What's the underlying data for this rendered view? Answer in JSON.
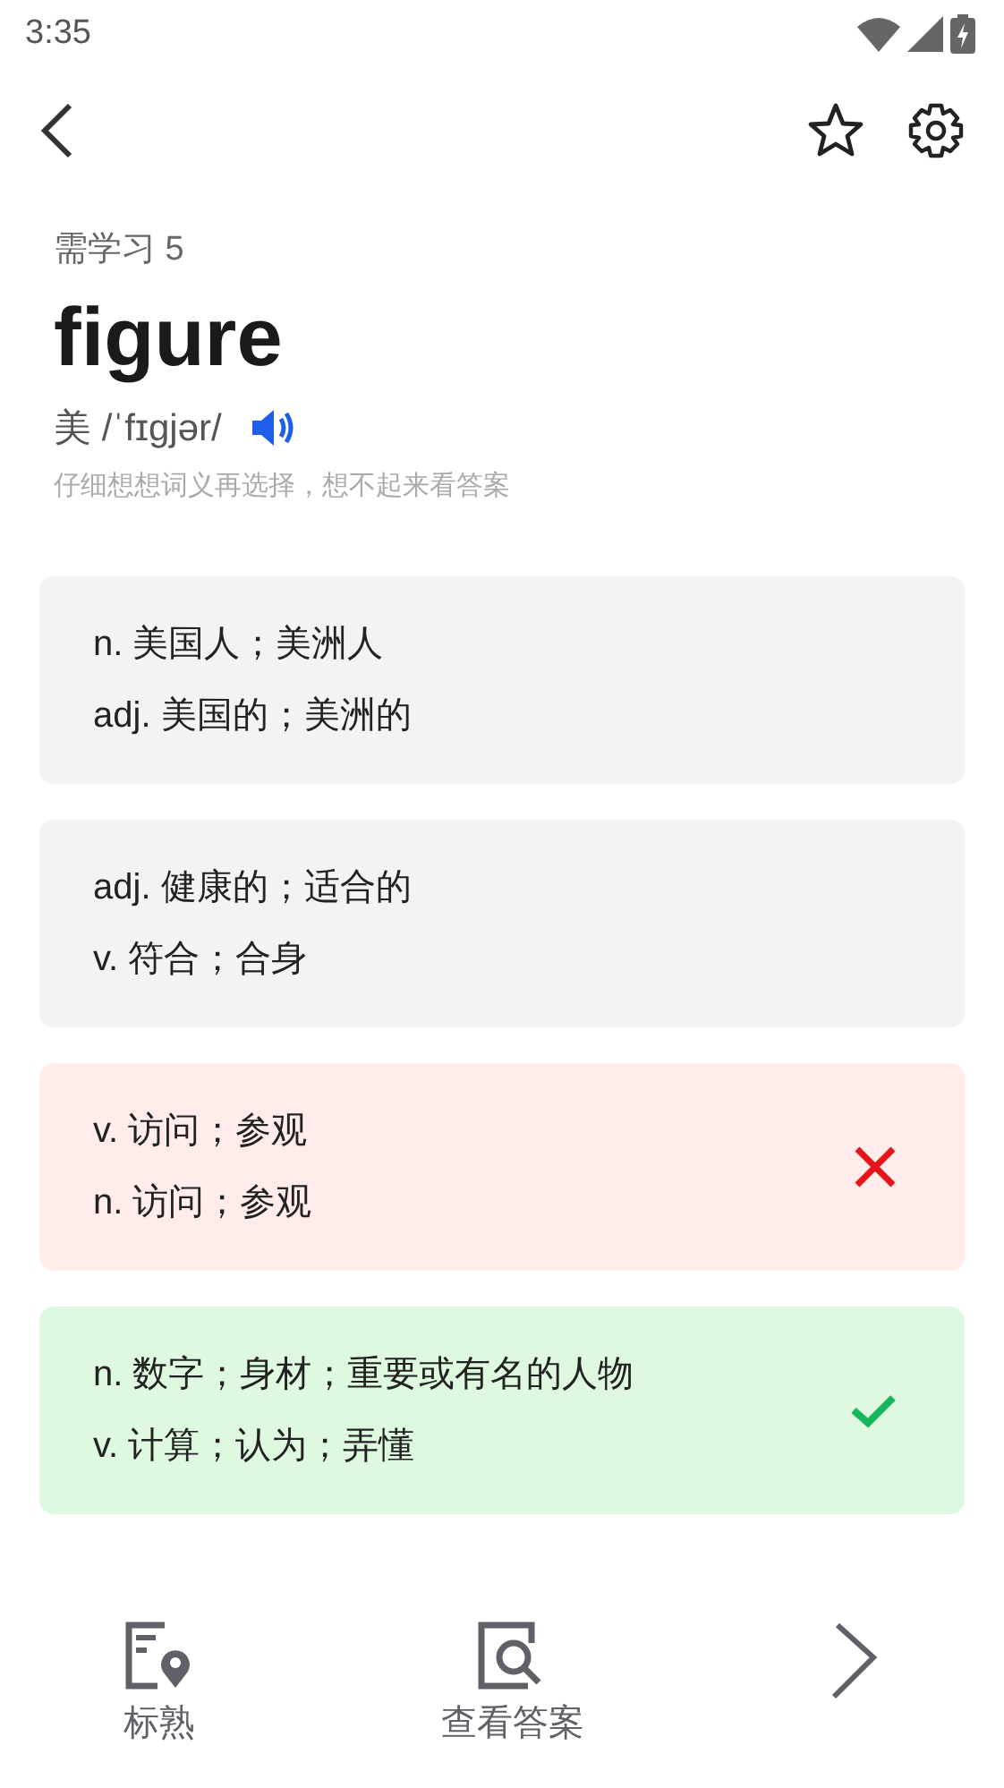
{
  "status_bar": {
    "time": "3:35"
  },
  "progress": "需学习 5",
  "word": "figure",
  "pronunciation": "美 /ˈfɪgjər/",
  "hint": "仔细想想词义再选择，想不起来看答案",
  "options": [
    {
      "lines": [
        "n. 美国人；美洲人",
        "adj. 美国的；美洲的"
      ],
      "wrong": false,
      "correct": false
    },
    {
      "lines": [
        "adj. 健康的；适合的",
        "v. 符合；合身"
      ],
      "wrong": false,
      "correct": false
    },
    {
      "lines": [
        "v. 访问；参观",
        "n. 访问；参观"
      ],
      "wrong": true,
      "correct": false
    },
    {
      "lines": [
        "n. 数字；身材；重要或有名的人物",
        "v. 计算；认为；弄懂"
      ],
      "wrong": false,
      "correct": true
    }
  ],
  "bottom_actions": [
    {
      "kind": "mark",
      "label": "标熟"
    },
    {
      "kind": "answer",
      "label": "查看答案"
    },
    {
      "kind": "next"
    }
  ]
}
